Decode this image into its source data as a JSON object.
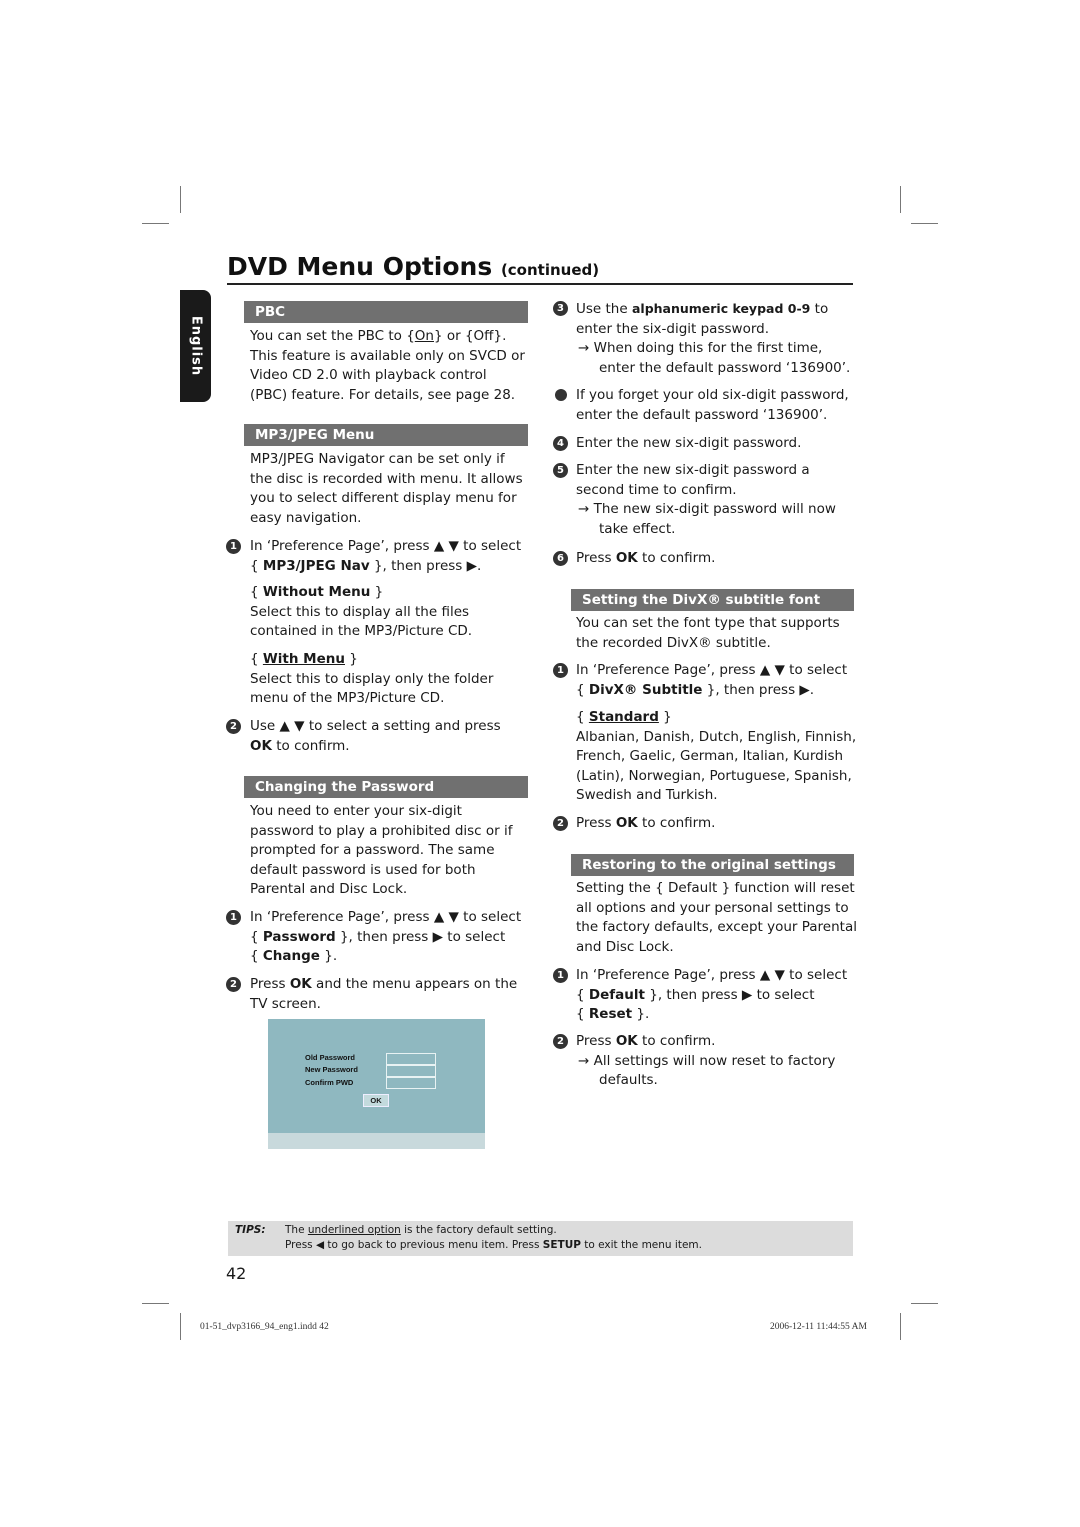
{
  "page": {
    "title": "DVD Menu Options",
    "title_suffix": "(continued)",
    "language_tab": "English",
    "page_number": "42"
  },
  "pbc": {
    "heading": "PBC",
    "body_pre": "You can set the PBC to {",
    "body_on": "On",
    "body_post": "} or {Off}.",
    "body_lines": [
      "This feature is available only on SVCD or",
      "Video CD 2.0 with playback control",
      "(PBC) feature. For details, see page 28."
    ]
  },
  "mp3": {
    "heading": "MP3/JPEG Menu",
    "intro": [
      "MP3/JPEG Navigator can be set only if",
      "the disc is recorded with menu. It allows",
      "you to select different display menu for",
      "easy navigation."
    ],
    "step1_num": "1",
    "step1_line1": "In ‘Preference Page’, press ▲ ▼ to select",
    "step1_pre": "{ ",
    "step1_bold": "MP3/JPEG Nav",
    "step1_post": " }, then press ▶.",
    "opt1_label": "Without Menu",
    "opt1_desc": [
      "Select this to display all the files",
      "contained in the MP3/Picture CD."
    ],
    "opt2_label": "With Menu",
    "opt2_desc": [
      "Select this to display only the folder",
      "menu of the MP3/Picture CD."
    ],
    "step2_num": "2",
    "step2_line1": "Use ▲ ▼ to select a setting and press",
    "step2_bold": "OK",
    "step2_post": " to confirm."
  },
  "password": {
    "heading": "Changing the Password",
    "intro": [
      "You need to enter your six-digit",
      "password to play a prohibited disc or if",
      "prompted for a password. The same",
      "default password is used for both",
      "Parental and Disc Lock."
    ],
    "step1_num": "1",
    "step1_line1": "In ‘Preference Page’, press ▲ ▼ to select",
    "step1_bold": "Password",
    "step1_post": " }, then press ▶ to select",
    "step1_bold2": "Change",
    "step2_num": "2",
    "step2_pre": "Press ",
    "step2_bold": "OK",
    "step2_post": " and the menu appears on the",
    "step2_line2": "TV screen.",
    "screen": {
      "labels": [
        "Old  Password",
        "New Password",
        "Confirm PWD"
      ],
      "ok_button": "OK"
    },
    "step3_num": "3",
    "step3_pre": "Use the ",
    "step3_bold": "alphanumeric keypad 0-9",
    "step3_post": " to",
    "step3_line2": "enter the six-digit password.",
    "step3_result": [
      "→ When doing this for the first time,",
      "enter the default password ‘136900’."
    ],
    "note": [
      "If you forget your old six-digit password,",
      "enter the default password ‘136900’."
    ],
    "step4_num": "4",
    "step4": "Enter the new six-digit password.",
    "step5_num": "5",
    "step5": [
      "Enter the new six-digit password a",
      "second time to confirm."
    ],
    "step5_result": [
      "→ The new six-digit password will now",
      "take effect."
    ],
    "step6_num": "6",
    "step6_pre": "Press ",
    "step6_bold": "OK",
    "step6_post": " to confirm."
  },
  "divx": {
    "heading": "Setting the DivX® subtitle font",
    "intro": [
      "You can set the font type that supports",
      "the recorded DivX® subtitle."
    ],
    "step1_num": "1",
    "step1_line1": "In ‘Preference Page’, press ▲ ▼ to select",
    "step1_bold": "DivX® Subtitle",
    "step1_post": " }, then press ▶.",
    "opt_label": "Standard",
    "opt_desc": [
      "Albanian, Danish, Dutch, English, Finnish,",
      "French, Gaelic, German, Italian, Kurdish",
      "(Latin), Norwegian, Portuguese, Spanish,",
      "Swedish and Turkish."
    ],
    "step2_num": "2",
    "step2_pre": "Press ",
    "step2_bold": "OK",
    "step2_post": " to confirm."
  },
  "restore": {
    "heading": "Restoring to the original settings",
    "intro": [
      "Setting the { Default } function will reset",
      "all options and your personal settings to",
      "the factory defaults, except your Parental",
      "and Disc Lock."
    ],
    "step1_num": "1",
    "step1_line1": "In ‘Preference Page’, press ▲ ▼ to select",
    "step1_bold": "Default",
    "step1_post": " }, then press ▶ to select",
    "step1_bold2": "Reset",
    "step2_num": "2",
    "step2_pre": "Press ",
    "step2_bold": "OK",
    "step2_post": " to confirm.",
    "step2_result": [
      "→ All settings will now reset to factory",
      "defaults."
    ]
  },
  "tips": {
    "label": "TIPS:",
    "line1_pre": "The ",
    "line1_u": "underlined option",
    "line1_post": " is the factory default setting.",
    "line2_pre": "Press  ◀ to go back to previous menu item. Press ",
    "line2_bold": "SETUP",
    "line2_post": " to exit the menu item."
  },
  "slug": {
    "file": "01-51_dvp3166_94_eng1.indd   42",
    "timestamp": "2006-12-11   11:44:55 AM"
  }
}
